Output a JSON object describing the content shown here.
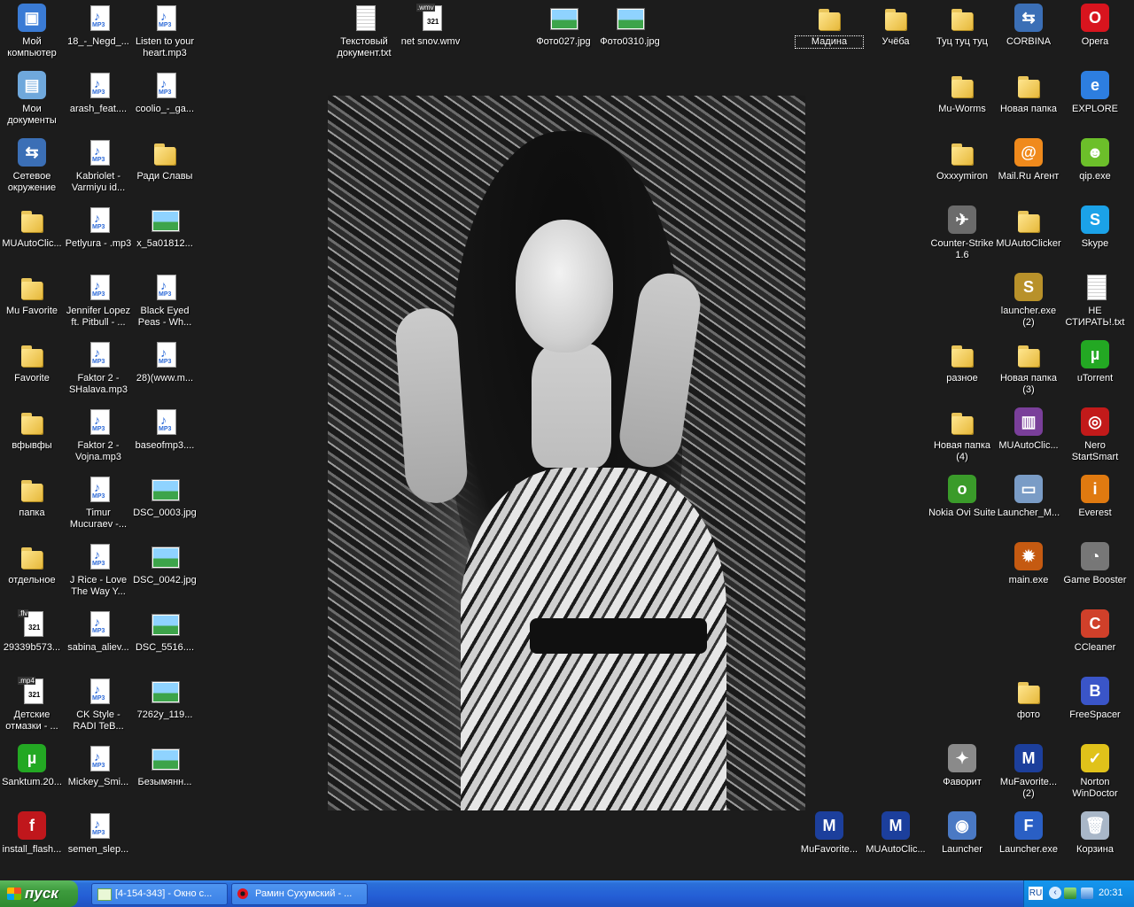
{
  "desktop": {
    "wallpaper": "black-and-white portrait photo",
    "icons": {
      "c0": [
        {
          "label": "Мой компьютер",
          "type": "computer"
        },
        {
          "label": "Мои документы",
          "type": "documents"
        },
        {
          "label": "Сетевое окружение",
          "type": "network"
        },
        {
          "label": "MUAutoClic...",
          "type": "folder"
        },
        {
          "label": "Mu Favorite",
          "type": "folder"
        },
        {
          "label": "Favorite",
          "type": "folder"
        },
        {
          "label": "вфывфы",
          "type": "folder"
        },
        {
          "label": "папка",
          "type": "folder"
        },
        {
          "label": "отдельное",
          "type": "folder"
        },
        {
          "label": "29339b573...",
          "type": "video",
          "tag": "flv"
        },
        {
          "label": "Детские отмазки - ...",
          "type": "video",
          "tag": "mp4"
        },
        {
          "label": "Sanktum.20...",
          "type": "utorrent"
        },
        {
          "label": "install_flash...",
          "type": "flash"
        }
      ],
      "c1": [
        {
          "label": "18_-_Negd_...",
          "type": "mp3"
        },
        {
          "label": "arash_feat....",
          "type": "mp3"
        },
        {
          "label": "Kabriolet - Varmiyu id...",
          "type": "mp3"
        },
        {
          "label": "Petlyura - .mp3",
          "type": "mp3"
        },
        {
          "label": "Jennifer Lopez ft. Pitbull - ...",
          "type": "mp3"
        },
        {
          "label": "Faktor 2 - SHalava.mp3",
          "type": "mp3"
        },
        {
          "label": "Faktor 2 - Vojna.mp3",
          "type": "mp3"
        },
        {
          "label": "Timur Mucuraev -...",
          "type": "mp3"
        },
        {
          "label": "J Rice - Love The Way Y...",
          "type": "mp3"
        },
        {
          "label": "sabina_aliev...",
          "type": "mp3"
        },
        {
          "label": "CK Style - RADI TeB...",
          "type": "mp3"
        },
        {
          "label": "Mickey_Smi...",
          "type": "mp3"
        },
        {
          "label": "semen_slep...",
          "type": "mp3"
        }
      ],
      "c2": [
        {
          "label": "Listen to your heart.mp3",
          "type": "mp3"
        },
        {
          "label": "coolio_-_ga...",
          "type": "mp3"
        },
        {
          "label": "Ради Славы",
          "type": "folder"
        },
        {
          "label": "x_5a01812...",
          "type": "image"
        },
        {
          "label": "Black Eyed Peas - Wh...",
          "type": "mp3"
        },
        {
          "label": "28)(www.m...",
          "type": "mp3"
        },
        {
          "label": "baseofmp3....",
          "type": "mp3"
        },
        {
          "label": "DSC_0003.jpg",
          "type": "image"
        },
        {
          "label": "DSC_0042.jpg",
          "type": "image"
        },
        {
          "label": "DSC_5516....",
          "type": "image"
        },
        {
          "label": "7262y_119...",
          "type": "image"
        },
        {
          "label": "Безымянн...",
          "type": "image"
        }
      ],
      "top": [
        {
          "label": "Текстовый документ.txt",
          "type": "txt"
        },
        {
          "label": "net snov.wmv",
          "type": "video",
          "tag": "wmv"
        },
        {
          "label": "Фото027.jpg",
          "type": "image"
        },
        {
          "label": "Фото0310.jpg",
          "type": "image"
        }
      ],
      "c3": [
        {
          "label": "Мадина",
          "type": "folder",
          "selected": true
        },
        {
          "label": "MuFavorite...",
          "type": "mu"
        }
      ],
      "c4": [
        {
          "label": "Учёба",
          "type": "folder"
        },
        {
          "label": "MUAutoClic...",
          "type": "mu"
        }
      ],
      "c5": [
        {
          "label": "Туц туц туц",
          "type": "folder"
        },
        {
          "label": "Mu-Worms",
          "type": "folder"
        },
        {
          "label": "Oxxxymiron",
          "type": "folder"
        },
        {
          "label": "Counter-Strike 1.6",
          "type": "cs"
        },
        {
          "label": "разное",
          "type": "folder"
        },
        {
          "label": "Новая папка (4)",
          "type": "folder"
        },
        {
          "label": "Nokia Ovi Suite",
          "type": "ovi"
        },
        {
          "label": "Фаворит",
          "type": "gear"
        },
        {
          "label": "Launcher",
          "type": "launcher"
        }
      ],
      "c6": [
        {
          "label": "CORBINA",
          "type": "network"
        },
        {
          "label": "Новая папка",
          "type": "folder"
        },
        {
          "label": "Mail.Ru Агент",
          "type": "mailru"
        },
        {
          "label": "MUAutoClicker",
          "type": "folder"
        },
        {
          "label": "launcher.exe (2)",
          "type": "launcherexe"
        },
        {
          "label": "Новая папка (3)",
          "type": "folder"
        },
        {
          "label": "MUAutoClic...",
          "type": "winrar"
        },
        {
          "label": "Launcher_M...",
          "type": "window"
        },
        {
          "label": "main.exe",
          "type": "mainexe"
        },
        {
          "label": "фото",
          "type": "folder"
        },
        {
          "label": "MuFavorite... (2)",
          "type": "mu"
        },
        {
          "label": "Launcher.exe",
          "type": "flaunch"
        }
      ],
      "c7": [
        {
          "label": "Opera",
          "type": "opera"
        },
        {
          "label": "EXPLORE",
          "type": "ie"
        },
        {
          "label": "qip.exe",
          "type": "qip"
        },
        {
          "label": "Skype",
          "type": "skype"
        },
        {
          "label": "НЕ СТИРАТЬ!.txt",
          "type": "txt"
        },
        {
          "label": "uTorrent",
          "type": "utorrent"
        },
        {
          "label": "Nero StartSmart",
          "type": "nero"
        },
        {
          "label": "Everest",
          "type": "everest"
        },
        {
          "label": "Game Booster",
          "type": "booster"
        },
        {
          "label": "CCleaner",
          "type": "ccleaner"
        },
        {
          "label": "FreeSpacer",
          "type": "freespacer"
        },
        {
          "label": "Norton WinDoctor",
          "type": "norton"
        },
        {
          "label": "Корзина",
          "type": "recycle"
        }
      ]
    }
  },
  "taskbar": {
    "start_label": "пуск",
    "tasks": [
      {
        "label": "[4-154-343] - Окно с...",
        "icon": "notepad-icon"
      },
      {
        "label": "Рамин Сухумский - ...",
        "icon": "opera-icon"
      }
    ],
    "tray": {
      "language": "RU",
      "clock": "20:31"
    }
  },
  "colors": {
    "desktop_bg": "#1c1c1c",
    "taskbar": "#245ed6",
    "start_green": "#3d9b3d",
    "tray": "#0e7fd6"
  }
}
